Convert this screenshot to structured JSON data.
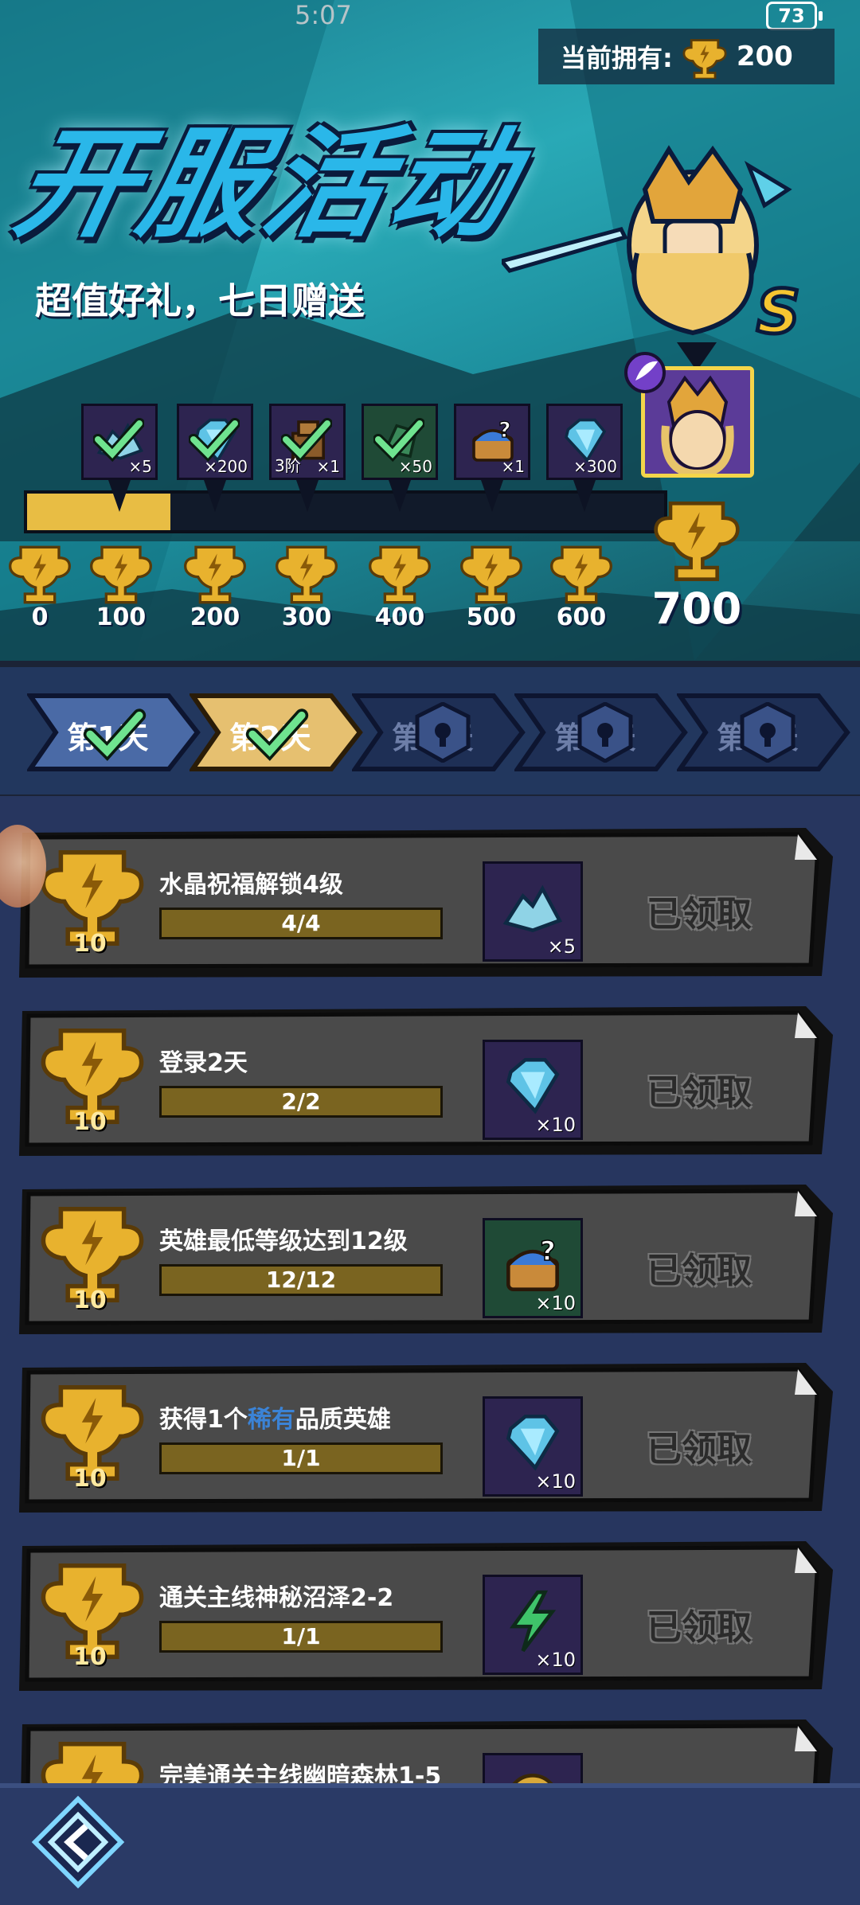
{
  "status_bar": {
    "time": "5:07",
    "battery": "73"
  },
  "header": {
    "currency_label": "当前拥有:",
    "currency_value": "200",
    "title": "开服活动",
    "subtitle": "超值好礼，七日赠送",
    "hero_rank": "S"
  },
  "progress": {
    "current": 200,
    "max": 700,
    "milestones": [
      "0",
      "100",
      "200",
      "300",
      "400",
      "500",
      "600"
    ],
    "final_milestone": "700",
    "rewards": [
      {
        "qty": "×5",
        "claimed": true,
        "icon": "crystal-shard-icon"
      },
      {
        "qty": "×200",
        "claimed": true,
        "icon": "diamond-icon"
      },
      {
        "tier": "3阶",
        "qty": "×1",
        "claimed": true,
        "icon": "equipment-chest-icon"
      },
      {
        "qty": "×50",
        "claimed": true,
        "icon": "green-token-icon"
      },
      {
        "qty": "×1",
        "claimed": false,
        "icon": "mystery-chest-icon"
      },
      {
        "qty": "×300",
        "claimed": false,
        "icon": "diamond-icon"
      }
    ]
  },
  "day_tabs": [
    {
      "label": "第1天",
      "state": "completed"
    },
    {
      "label": "第2天",
      "state": "active"
    },
    {
      "label": "第3天",
      "state": "locked"
    },
    {
      "label": "第4天",
      "state": "locked"
    },
    {
      "label": "第5天",
      "state": "locked"
    }
  ],
  "quests": [
    {
      "points": "10",
      "title": "水晶祝福解锁4级",
      "progress": "4/4",
      "reward_qty": "×5",
      "reward_icon": "crystal-shard-icon",
      "status": "已领取"
    },
    {
      "points": "10",
      "title": "登录2天",
      "progress": "2/2",
      "reward_qty": "×10",
      "reward_icon": "diamond-icon",
      "status": "已领取"
    },
    {
      "points": "10",
      "title": "英雄最低等级达到12级",
      "progress": "12/12",
      "reward_qty": "×10",
      "reward_icon": "mystery-chest-icon",
      "status": "已领取"
    },
    {
      "points": "10",
      "title_pre": "获得1个",
      "title_rare": "稀有",
      "title_post": "品质英雄",
      "progress": "1/1",
      "reward_qty": "×10",
      "reward_icon": "diamond-icon",
      "status": "已领取"
    },
    {
      "points": "10",
      "title": "通关主线神秘沼泽2-2",
      "progress": "1/1",
      "reward_qty": "×10",
      "reward_icon": "energy-icon",
      "status": "已领取"
    },
    {
      "points": "10",
      "title": "完美通关主线幽暗森林1-5",
      "progress": "",
      "reward_qty": "",
      "reward_icon": "coin-icon",
      "status": ""
    }
  ],
  "colors": {
    "accent_gold": "#e8bd44",
    "teal": "#29a9b6",
    "panel": "#4a4a4a",
    "rare_blue": "#3b83d6"
  }
}
